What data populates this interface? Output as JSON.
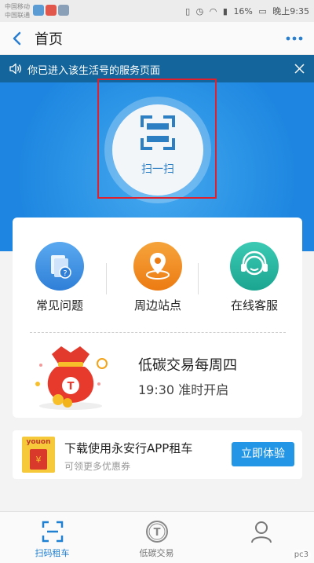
{
  "status_bar": {
    "carrier_1": "中国移动",
    "carrier_2": "中国联通",
    "battery": "16%",
    "time": "晚上9:35"
  },
  "nav": {
    "title": "首页"
  },
  "notice": {
    "text": "你已进入该生活号的服务页面"
  },
  "hero": {
    "scan_label": "扫一扫"
  },
  "services": [
    {
      "label": "常见问题",
      "icon": "faq-icon",
      "color": "#3a8ee6"
    },
    {
      "label": "周边站点",
      "icon": "location-icon",
      "color": "#f08a1c"
    },
    {
      "label": "在线客服",
      "icon": "customer-service-icon",
      "color": "#25b8a2"
    }
  ],
  "promo": {
    "title": "低碳交易每周四",
    "subtitle": "19:30 准时开启"
  },
  "banner": {
    "logo_text": "youon",
    "title": "下载使用永安行APP租车",
    "subtitle": "可领更多优惠券",
    "button": "立即体验"
  },
  "tabs": [
    {
      "label": "扫码租车",
      "icon": "scan-icon",
      "active": true
    },
    {
      "label": "低碳交易",
      "icon": "carbon-trade-icon",
      "active": false
    },
    {
      "label": "",
      "icon": "profile-icon",
      "active": false
    }
  ],
  "watermark": "pc3"
}
